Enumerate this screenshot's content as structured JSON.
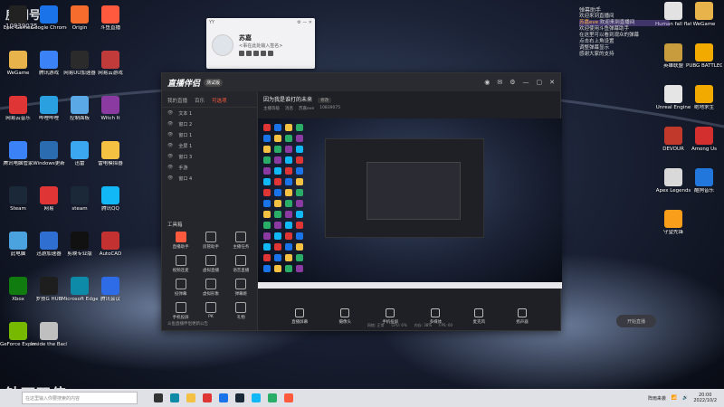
{
  "overlay": {
    "room_label": "房间号",
    "room_number": "10839075",
    "watermark": "钻石双倍"
  },
  "desktop_left": [
    {
      "label": "Epic Games",
      "color": "#222"
    },
    {
      "label": "Google Chrome",
      "color": "#1a73e8"
    },
    {
      "label": "Origin",
      "color": "#f56c2d"
    },
    {
      "label": "斗鱼直播",
      "color": "#ff5a3d"
    },
    {
      "label": "WeGame",
      "color": "#e8b34a"
    },
    {
      "label": "腾讯游戏",
      "color": "#3b82f6"
    },
    {
      "label": "网易UU加速器",
      "color": "#2b2b2b"
    },
    {
      "label": "网易云游戏",
      "color": "#c23b3b"
    },
    {
      "label": "网易云音乐",
      "color": "#e03535"
    },
    {
      "label": "哔哩哔哩",
      "color": "#2ba0e0"
    },
    {
      "label": "控制面板",
      "color": "#5aa9e6"
    },
    {
      "label": "Witch It",
      "color": "#8a3aa0"
    },
    {
      "label": "腾讯电脑管家",
      "color": "#3b82f6"
    },
    {
      "label": "Windows更新",
      "color": "#2b6cb0"
    },
    {
      "label": "迅雷",
      "color": "#3ba7f0"
    },
    {
      "label": "雷电模拟器",
      "color": "#f4c142"
    },
    {
      "label": "Steam",
      "color": "#1b2838"
    },
    {
      "label": "网易",
      "color": "#e03535"
    },
    {
      "label": "steam",
      "color": "#1b2838"
    },
    {
      "label": "腾讯QQ",
      "color": "#12b7f5"
    },
    {
      "label": "此电脑",
      "color": "#4aa3df"
    },
    {
      "label": "迅游加速器",
      "color": "#2f6fd1"
    },
    {
      "label": "剪映专业版",
      "color": "#111"
    },
    {
      "label": "AutoCAD",
      "color": "#c43131"
    },
    {
      "label": "Xbox",
      "color": "#107c10"
    },
    {
      "label": "罗技G HUB",
      "color": "#1e1e1e"
    },
    {
      "label": "Microsoft Edge",
      "color": "#0c8aa8"
    },
    {
      "label": "腾讯会议",
      "color": "#2e6be6"
    },
    {
      "label": "GeForce Experience",
      "color": "#76b900"
    },
    {
      "label": "Inside the Backrooms",
      "color": "#bfbfbf"
    }
  ],
  "desktop_right": [
    {
      "label": "Human fall flat",
      "color": "#e2e2e2"
    },
    {
      "label": "WeGame",
      "color": "#e8b34a"
    },
    {
      "label": "英雄联盟",
      "color": "#c89b3c"
    },
    {
      "label": "PUBG BATTLEGROUNDS",
      "color": "#f2a900"
    },
    {
      "label": "Unreal Engine",
      "color": "#e5e5e5"
    },
    {
      "label": "绝地求生",
      "color": "#f2a900"
    },
    {
      "label": "DEVOUR",
      "color": "#c0392b"
    },
    {
      "label": "Among Us",
      "color": "#d32f2f"
    },
    {
      "label": "Apex Legends",
      "color": "#d9d9d9"
    },
    {
      "label": "酷狗音乐",
      "color": "#2277dd"
    },
    {
      "label": "守望先锋",
      "color": "#f99e1a"
    }
  ],
  "profile": {
    "name": "苏嘉",
    "signature": "<事在此处输入签名>",
    "window_label": "YY"
  },
  "app": {
    "logo": "直播伴侣",
    "beta": "测试版",
    "tabs": [
      "我的直播",
      "百乐",
      "可选项"
    ],
    "scenes": [
      "文本 1",
      "窗口 2",
      "窗口 1",
      "全屏 1",
      "窗口 3",
      "手游",
      "窗口 4"
    ],
    "tools_title": "工具箱",
    "tools": [
      "直播助手",
      "房管助手",
      "主播任务",
      "视频连麦",
      "虚拟直播",
      "语音直播",
      "投弹幕",
      "虚拟形象",
      "弹幕姬",
      "手机投屏",
      "PK",
      "礼物"
    ],
    "footer_text": "斗鱼直播伴侣更新公告",
    "room_title": "因为我是谁打的未来",
    "room_tag": "修改",
    "room_meta": [
      "主播等级",
      "消息",
      "苏嘉eve",
      "10839075"
    ],
    "controls": [
      "直播屏幕",
      "摄像头",
      "手机投屏",
      "多媒体",
      "麦克风",
      "扬声器"
    ],
    "go_live": "开始直播",
    "status": [
      "网络: 正常",
      "CPU: 6%",
      "内存: 38%",
      "FPS: 60"
    ]
  },
  "chat": {
    "header": "弹幕助手",
    "lines": [
      {
        "nick": "",
        "text": "欢迎来到直播间",
        "hi": false
      },
      {
        "nick": "苏嘉eve",
        "text": "欢迎来到直播间",
        "hi": true
      },
      {
        "nick": "",
        "text": "欢迎使用斗鱼弹幕助手",
        "hi": false
      },
      {
        "nick": "",
        "text": "在这里可以看到观众的弹幕",
        "hi": false
      },
      {
        "nick": "",
        "text": "点击右上角设置",
        "hi": false
      },
      {
        "nick": "",
        "text": "调整弹幕显示",
        "hi": false
      },
      {
        "nick": "",
        "text": "感谢大家的支持",
        "hi": false
      }
    ]
  },
  "taskbar": {
    "search_placeholder": "在这里输入你要搜索的内容",
    "tray_text": "阵雨来袭",
    "time": "20:00",
    "date": "2022/10/2"
  }
}
